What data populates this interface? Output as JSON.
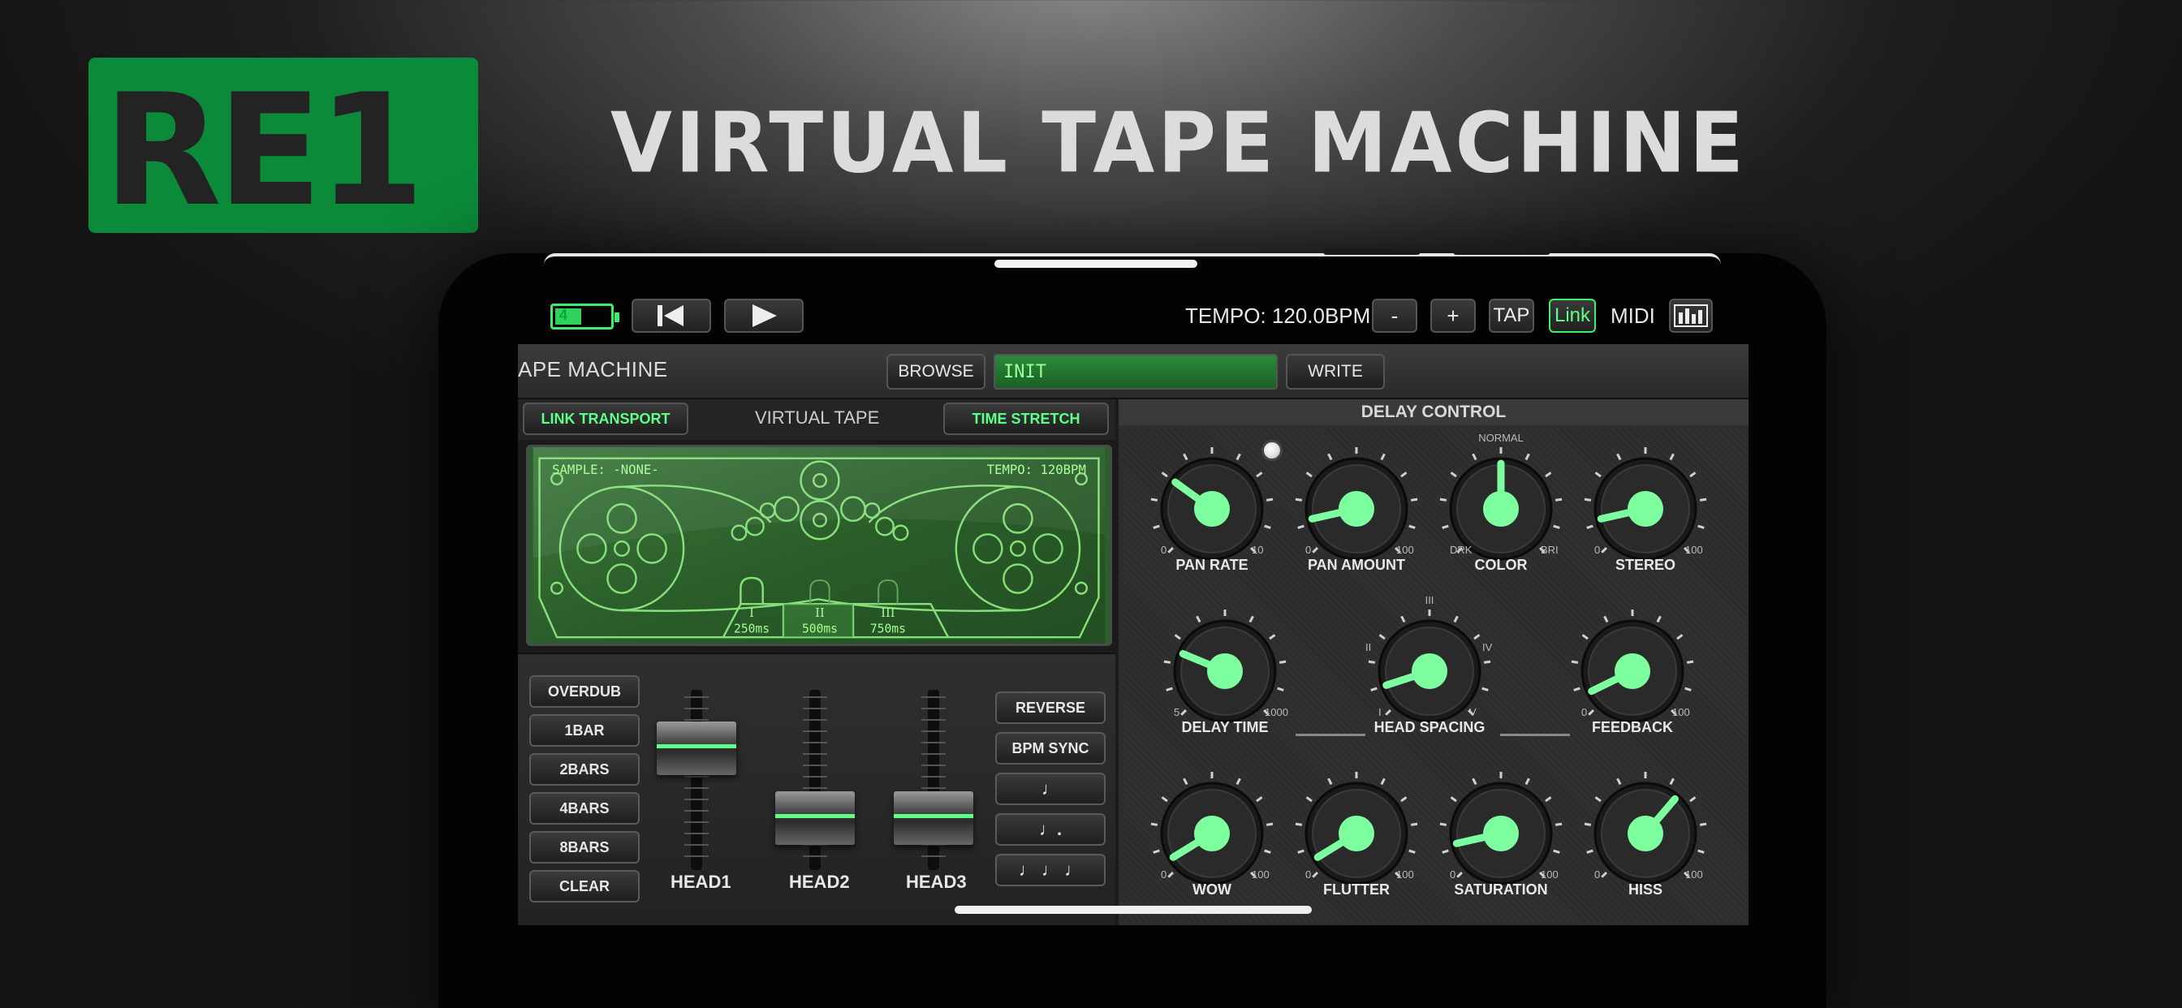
{
  "branding": {
    "logo_text": "RE1",
    "headline": "VIRTUAL TAPE MACHINE"
  },
  "colors": {
    "accent": "#5dff86",
    "brand_green": "#0b8a3a",
    "tape_display": "#2b5f2b"
  },
  "topbar": {
    "battery_level": "4",
    "rewind_icon": "skip-back-icon",
    "play_icon": "play-icon",
    "tempo_label": "TEMPO: 120.0BPM",
    "minus": "-",
    "plus": "+",
    "tap": "TAP",
    "link": "Link",
    "midi": "MIDI"
  },
  "header": {
    "title": "APE MACHINE",
    "browse": "BROWSE",
    "preset": "INIT",
    "write": "WRITE"
  },
  "tape": {
    "link_transport": "LINK TRANSPORT",
    "virtual_tape": "VIRTUAL TAPE",
    "time_stretch": "TIME STRETCH",
    "sample": "SAMPLE: -NONE-",
    "tempo": "TEMPO: 120BPM",
    "heads": [
      {
        "num": "I",
        "time": "250ms"
      },
      {
        "num": "II",
        "time": "500ms"
      },
      {
        "num": "III",
        "time": "750ms"
      }
    ]
  },
  "mixer": {
    "left_buttons": [
      "OVERDUB",
      "1BAR",
      "2BARS",
      "4BARS",
      "8BARS",
      "CLEAR"
    ],
    "right_buttons": [
      "REVERSE",
      "BPM SYNC",
      "♩",
      "♩.",
      "♩ ♩ ♩"
    ],
    "faders": [
      {
        "label": "HEAD1",
        "level": 0.75
      },
      {
        "label": "HEAD2",
        "level": 0.2
      },
      {
        "label": "HEAD3",
        "level": 0.2
      }
    ]
  },
  "delay": {
    "title": "DELAY CONTROL",
    "knobs": [
      {
        "label": "PAN RATE",
        "min": "0",
        "max": "10",
        "value": 0.3
      },
      {
        "label": "PAN AMOUNT",
        "min": "0",
        "max": "100",
        "value": 0.12
      },
      {
        "label": "COLOR",
        "min": "DRK",
        "max": "BRI",
        "top": "NORMAL",
        "value": 0.5
      },
      {
        "label": "STEREO",
        "min": "0",
        "max": "100",
        "value": 0.12
      },
      {
        "label": "DELAY TIME",
        "min": "5",
        "max": "1000",
        "value": 0.25
      },
      {
        "label": "HEAD SPACING",
        "min": "I",
        "max": "V",
        "left": "II",
        "right": "IV",
        "top": "III",
        "value": 0.1
      },
      {
        "label": "FEEDBACK",
        "min": "0",
        "max": "100",
        "value": 0.07
      },
      {
        "label": "WOW",
        "min": "0",
        "max": "100",
        "value": 0.05
      },
      {
        "label": "FLUTTER",
        "min": "0",
        "max": "100",
        "value": 0.05
      },
      {
        "label": "SATURATION",
        "min": "0",
        "max": "100",
        "value": 0.12
      },
      {
        "label": "HISS",
        "min": "0",
        "max": "100",
        "value": 0.65
      }
    ]
  }
}
